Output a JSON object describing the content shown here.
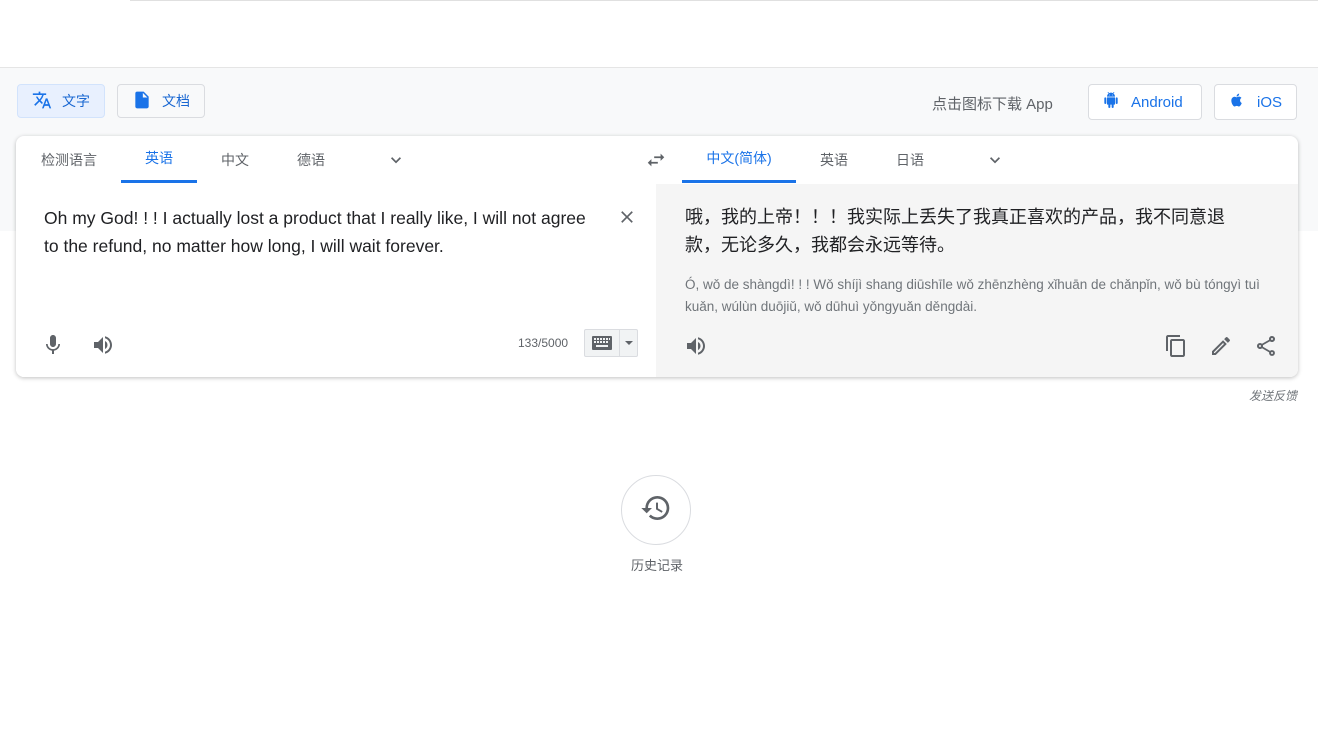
{
  "modes": [
    {
      "label": "文字",
      "icon": "translate-icon"
    },
    {
      "label": "文档",
      "icon": "document-icon"
    }
  ],
  "download": {
    "text": "点击图标下载 App",
    "android": "Android",
    "ios": "iOS"
  },
  "source_langs": [
    "检测语言",
    "英语",
    "中文",
    "德语"
  ],
  "target_langs": [
    "中文(简体)",
    "英语",
    "日语"
  ],
  "source": {
    "text": "Oh my God! ! ! I actually lost a product that I really like, I will not agree to the refund, no matter how long, I will wait forever.",
    "char_count": "133/5000"
  },
  "target": {
    "text": "哦，我的上帝！！！我实际上丢失了我真正喜欢的产品，我不同意退款，无论多久，我都会永远等待。",
    "romanization": "Ó, wǒ de shàngdì! ! ! Wǒ shíjì shang diūshīle wǒ zhēnzhèng xǐhuān de chǎnpǐn, wǒ bù tóngyì tuì kuǎn, wúlùn duōjiǔ, wǒ dūhuì yǒngyuǎn děngdài."
  },
  "feedback": "发送反馈",
  "history": "历史记录",
  "colors": {
    "accent": "#1a73e8",
    "band": "#f8f9fa",
    "target_bg": "#f5f5f5"
  }
}
